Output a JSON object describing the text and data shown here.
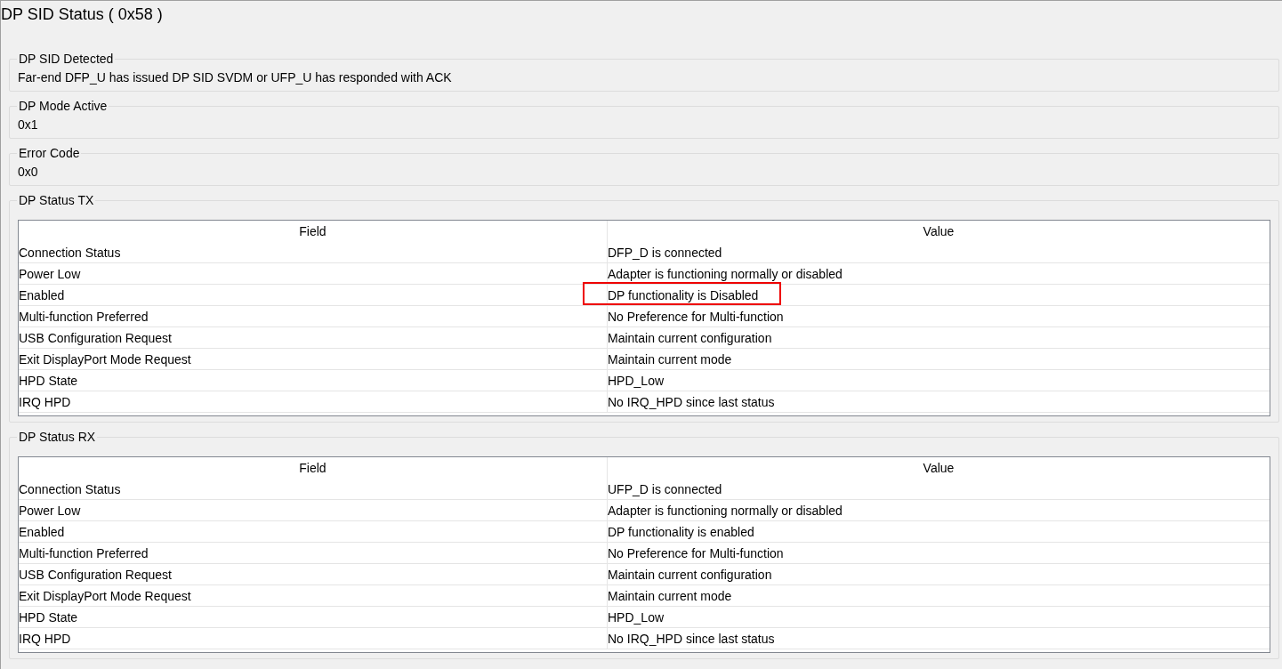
{
  "title": "DP SID Status  ( 0x58 )",
  "groups": [
    {
      "kind": "text",
      "label": "DP SID Detected",
      "value": "Far-end DFP_U has issued DP SID SVDM or UFP_U has responded with ACK"
    },
    {
      "kind": "text",
      "label": "DP Mode Active",
      "value": "0x1"
    },
    {
      "kind": "text",
      "label": "Error Code",
      "value": "0x0"
    },
    {
      "kind": "table",
      "label": "DP Status TX",
      "columns": [
        "Field",
        "Value"
      ],
      "rows": [
        {
          "field": "Connection Status",
          "value": "DFP_D is connected",
          "highlighted": false
        },
        {
          "field": "Power Low",
          "value": "Adapter is functioning normally or disabled",
          "highlighted": false
        },
        {
          "field": "Enabled",
          "value": "DP functionality is Disabled",
          "highlighted": true
        },
        {
          "field": "Multi-function Preferred",
          "value": "No Preference for Multi-function",
          "highlighted": false
        },
        {
          "field": "USB Configuration Request",
          "value": "Maintain current configuration",
          "highlighted": false
        },
        {
          "field": "Exit DisplayPort Mode Request",
          "value": "Maintain current mode",
          "highlighted": false
        },
        {
          "field": "HPD State",
          "value": "HPD_Low",
          "highlighted": false
        },
        {
          "field": "IRQ HPD",
          "value": "No IRQ_HPD since last status",
          "highlighted": false
        }
      ]
    },
    {
      "kind": "table",
      "label": "DP Status RX",
      "columns": [
        "Field",
        "Value"
      ],
      "rows": [
        {
          "field": "Connection Status",
          "value": "UFP_D is connected",
          "highlighted": false
        },
        {
          "field": "Power Low",
          "value": "Adapter is functioning normally or disabled",
          "highlighted": false
        },
        {
          "field": "Enabled",
          "value": "DP functionality is enabled",
          "highlighted": false
        },
        {
          "field": "Multi-function Preferred",
          "value": "No Preference for Multi-function",
          "highlighted": false
        },
        {
          "field": "USB Configuration Request",
          "value": "Maintain current configuration",
          "highlighted": false
        },
        {
          "field": "Exit DisplayPort Mode Request",
          "value": "Maintain current mode",
          "highlighted": false
        },
        {
          "field": "HPD State",
          "value": "HPD_Low",
          "highlighted": false
        },
        {
          "field": "IRQ HPD",
          "value": "No IRQ_HPD since last status",
          "highlighted": false
        }
      ]
    }
  ]
}
